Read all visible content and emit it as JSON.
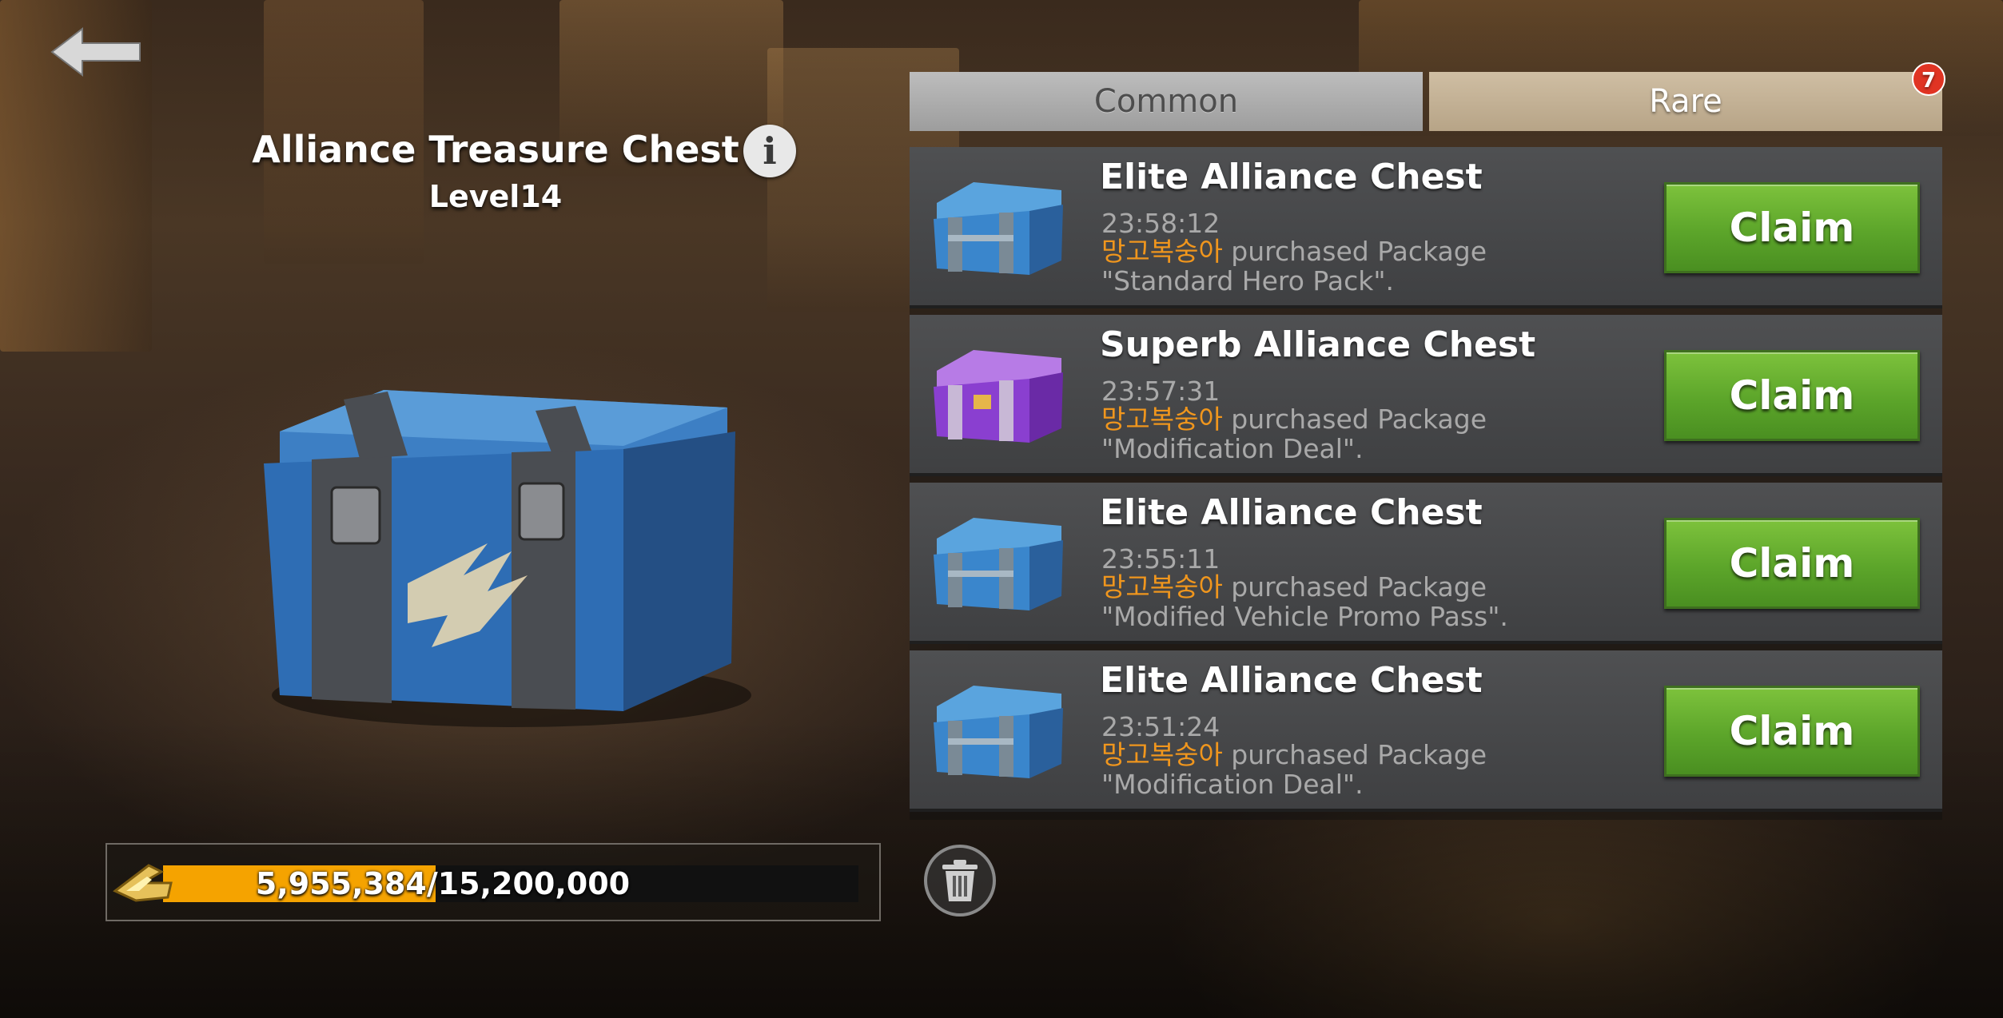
{
  "header": {
    "back_icon": "back-arrow-icon",
    "chest_name": "Alliance Treasure Chest",
    "chest_level": "Level14",
    "info_icon": "info-icon",
    "info_glyph": "i"
  },
  "progress": {
    "text": "5,955,384/15,200,000",
    "current": 5955384,
    "max": 15200000,
    "fraction": 0.392,
    "icon": "alliance-key-icon",
    "fill_color": "#f5a300"
  },
  "tabs": [
    {
      "label": "Common",
      "active": false
    },
    {
      "label": "Rare",
      "active": true,
      "badge": "7"
    }
  ],
  "list": [
    {
      "title": "Elite Alliance Chest",
      "time": "23:58:12",
      "player": "망고복숭아",
      "action": " purchased Package",
      "package": "\"Standard Hero Pack\".",
      "icon": "blue-chest-icon",
      "claim_label": "Claim"
    },
    {
      "title": "Superb Alliance Chest",
      "time": "23:57:31",
      "player": "망고복숭아",
      "action": " purchased Package",
      "package": "\"Modification Deal\".",
      "icon": "purple-chest-icon",
      "claim_label": "Claim"
    },
    {
      "title": "Elite Alliance Chest",
      "time": "23:55:11",
      "player": "망고복숭아",
      "action": " purchased Package",
      "package": "\"Modified Vehicle Promo Pass\".",
      "icon": "blue-chest-icon",
      "claim_label": "Claim"
    },
    {
      "title": "Elite Alliance Chest",
      "time": "23:51:24",
      "player": "망고복숭아",
      "action": " purchased Package",
      "package": "\"Modification Deal\".",
      "icon": "blue-chest-icon",
      "claim_label": "Claim"
    }
  ],
  "footer": {
    "trash_icon": "trash-icon"
  },
  "colors": {
    "accent_green": "#5ca52a",
    "player_name": "#f0961d",
    "badge_red": "#e03423",
    "progress_fill": "#f5a300"
  }
}
